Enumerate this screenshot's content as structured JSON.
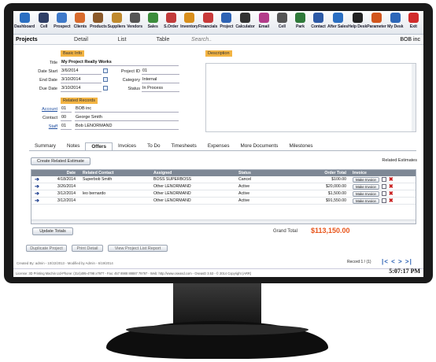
{
  "toolbar": [
    {
      "label": "Dashboard",
      "icon": "house-icon",
      "color": "#2b6fc2"
    },
    {
      "label": "Cell",
      "icon": "phone-icon",
      "color": "#2f3f66"
    },
    {
      "label": "Prospect",
      "icon": "person-icon",
      "color": "#3e79c9"
    },
    {
      "label": "Clients",
      "icon": "people-icon",
      "color": "#d86b2d"
    },
    {
      "label": "Products",
      "icon": "box-icon",
      "color": "#8b5a2b"
    },
    {
      "label": "Suppliers",
      "icon": "boot-icon",
      "color": "#c08a2e"
    },
    {
      "label": "Vendors",
      "icon": "vendor-icon",
      "color": "#555555"
    },
    {
      "label": "Sales",
      "icon": "money-icon",
      "color": "#3c8d3c"
    },
    {
      "label": "S.Order",
      "icon": "cart-icon",
      "color": "#c23b3b"
    },
    {
      "label": "Inventory",
      "icon": "inventory-icon",
      "color": "#d98f1c"
    },
    {
      "label": "Financials",
      "icon": "chart-icon",
      "color": "#c83a3a"
    },
    {
      "label": "Project",
      "icon": "pencil-icon",
      "color": "#2e63b4"
    },
    {
      "label": "Calculator",
      "icon": "calculator-icon",
      "color": "#333333"
    },
    {
      "label": "Email",
      "icon": "email-icon",
      "color": "#b33c8a"
    },
    {
      "label": "Cell",
      "icon": "cellphone-icon",
      "color": "#555555"
    },
    {
      "label": "Park",
      "icon": "park-icon",
      "color": "#2f7a3a"
    },
    {
      "label": "Contact",
      "icon": "contact-icon",
      "color": "#2d5aa6"
    },
    {
      "label": "After Sales",
      "icon": "tools-icon",
      "color": "#2b6fc2"
    },
    {
      "label": "Help Desk",
      "icon": "helpdesk-icon",
      "color": "#222222"
    },
    {
      "label": "Parameter",
      "icon": "wrench-icon",
      "color": "#d1561e"
    },
    {
      "label": "My Desk",
      "icon": "monitor-icon",
      "color": "#2d67b9"
    },
    {
      "label": "Exit",
      "icon": "power-icon",
      "color": "#d12b2b"
    }
  ],
  "nav": {
    "title": "Projects",
    "detail": "Detail",
    "list": "List",
    "table": "Table",
    "search_placeholder": "Search..",
    "company": "BOB inc"
  },
  "basic": {
    "section_label": "Basic Info",
    "title_label": "Title",
    "title": "My Project Really Works",
    "date_start_label": "Date Start",
    "date_start": "3/6/2014",
    "end_date_label": "End Date",
    "end_date": "3/10/2014",
    "due_date_label": "Due Date",
    "due_date": "3/10/2014",
    "project_id_label": "Project ID",
    "project_id": "01",
    "category_label": "Category",
    "category": "Internal",
    "status_label": "Status",
    "status": "In Process"
  },
  "related": {
    "section_label": "Related Records",
    "account_label": "Account",
    "account_code": "01",
    "account_name": "BOB inc",
    "contact_label": "Contact",
    "contact_code": "00",
    "contact_name": "George Smith",
    "staff_label": "Staff",
    "staff_code": "01",
    "staff_name": "Bob LENORMAND"
  },
  "description_label": "Description",
  "tabs": [
    "Summary",
    "Notes",
    "Offers",
    "Invoices",
    "To Do",
    "Timesheets",
    "Expenses",
    "More Documents",
    "Milestones"
  ],
  "active_tab": "Offers",
  "estimates": {
    "create_button": "Create Related Estimate",
    "related_label": "Related Estimates",
    "columns": [
      "",
      "Date",
      "Related Contact",
      "Assigned",
      "Status",
      "Order Total",
      "Invoice"
    ],
    "rows": [
      {
        "date": "4/18/2014",
        "contact": "Superbob Smith",
        "assigned": "BOSS SUPERBOSS",
        "status": "Cancel",
        "total": "$100.00",
        "action": "Make Invoice"
      },
      {
        "date": "3/26/2014",
        "contact": "",
        "assigned": "Other LENORMAND",
        "status": "Active",
        "total": "$20,000.00",
        "action": "Make Invoice"
      },
      {
        "date": "3/12/2014",
        "contact": "leo bernardo",
        "assigned": "Other LENORMAND",
        "status": "Active",
        "total": "$1,500.00",
        "action": "Make Invoice"
      },
      {
        "date": "3/12/2014",
        "contact": "",
        "assigned": "Other LENORMAND",
        "status": "Active",
        "total": "$91,550.00",
        "action": "Make Invoice"
      }
    ],
    "update_button": "Update Totals",
    "grand_total_label": "Grand Total",
    "grand_total": "$113,150.00"
  },
  "actions": {
    "duplicate": "Duplicate Project",
    "print": "Print Detail",
    "view_list": "View Project List Report"
  },
  "footer": {
    "created": "Created By: admin - 10/22/2013 - Modified by Admin - 6/19/2014",
    "record": "Record 1 / (1)",
    "nav_arrows": "|< < > >|",
    "license": "License: 3D Printing Machin Ltd-Phone: (314)495-4798 x7977 - Fax: 457 8988 88887 79797 - Web: http://www.oseasd.com - OseasD 3.53 - © 2014 Copyright (ARR)",
    "clock": "5:07:17 PM"
  }
}
